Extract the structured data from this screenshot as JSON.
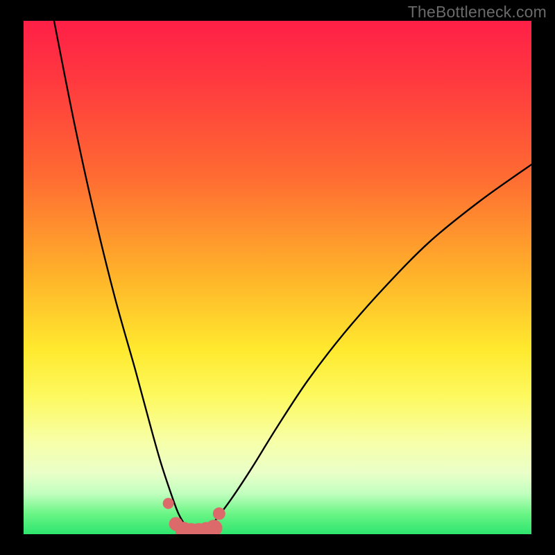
{
  "watermark": "TheBottleneck.com",
  "colors": {
    "frame": "#000000",
    "curve": "#000000",
    "marker_fill": "#dd6a6a",
    "marker_stroke": "#c24f4f",
    "gradient_top": "#ff1f47",
    "gradient_bottom": "#2de56e"
  },
  "chart_data": {
    "type": "line",
    "title": "",
    "xlabel": "",
    "ylabel": "",
    "xlim": [
      0,
      100
    ],
    "ylim": [
      0,
      100
    ],
    "grid": false,
    "legend": false,
    "note": "Axes are unlabeled; x/y values are estimated from pixel positions as percent of plot area. y=0 is bottom (green), y=100 is top (red). The two black curves form a V with minimum near x≈31–37, y≈0. Pink markers trace the bottom of the V.",
    "series": [
      {
        "name": "left-curve",
        "x": [
          6,
          10,
          14,
          18,
          22,
          25,
          27,
          29,
          30.5,
          32,
          33
        ],
        "y": [
          100,
          80,
          62,
          46,
          32,
          21,
          14,
          8,
          4,
          1.5,
          0.5
        ]
      },
      {
        "name": "right-curve",
        "x": [
          36,
          38,
          41,
          45,
          50,
          56,
          63,
          71,
          80,
          90,
          100
        ],
        "y": [
          0.5,
          3,
          7,
          13,
          21,
          30,
          39,
          48,
          57,
          65,
          72
        ]
      },
      {
        "name": "markers",
        "style": "points",
        "x": [
          28.5,
          30.0,
          31.5,
          33.0,
          34.5,
          36.0,
          37.5,
          38.5
        ],
        "y": [
          6.0,
          2.0,
          0.8,
          0.4,
          0.4,
          0.6,
          1.2,
          4.0
        ]
      }
    ]
  }
}
